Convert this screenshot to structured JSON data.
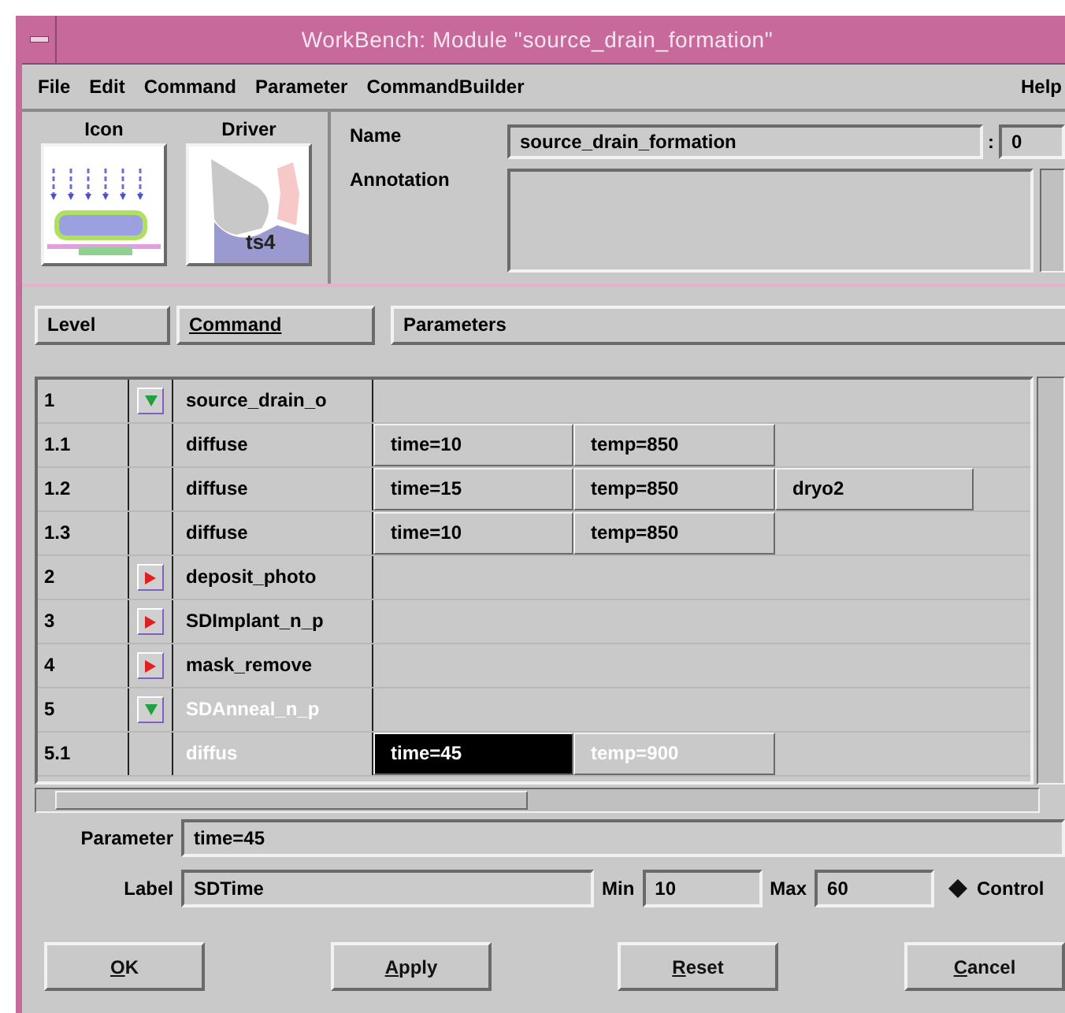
{
  "window": {
    "title": "WorkBench: Module \"source_drain_formation\""
  },
  "menu": {
    "items": [
      "File",
      "Edit",
      "Command",
      "Parameter",
      "CommandBuilder"
    ],
    "help": "Help"
  },
  "module": {
    "icon_label": "Icon",
    "driver_label": "Driver",
    "driver_badge": "ts4",
    "name_label": "Name",
    "name": "source_drain_formation",
    "separator": ":",
    "version": "0",
    "annotation_label": "Annotation"
  },
  "columns": [
    {
      "label": "Level",
      "sorted": false
    },
    {
      "label": "Command",
      "sorted": true
    },
    {
      "label": "Parameters",
      "sorted": false
    }
  ],
  "rows": [
    {
      "level": "1",
      "expanded": true,
      "command": "source_drain_o",
      "highlighted": false
    },
    {
      "level": "1.1",
      "command": "diffuse",
      "highlighted": false,
      "params": [
        {
          "text": "time=10",
          "selected": false
        },
        {
          "text": "temp=850",
          "selected": false
        }
      ]
    },
    {
      "level": "1.2",
      "command": "diffuse",
      "highlighted": false,
      "params": [
        {
          "text": "time=15",
          "selected": false
        },
        {
          "text": "temp=850",
          "selected": false
        },
        {
          "text": "dryo2",
          "selected": false
        }
      ]
    },
    {
      "level": "1.3",
      "command": "diffuse",
      "highlighted": false,
      "params": [
        {
          "text": "time=10",
          "selected": false
        },
        {
          "text": "temp=850",
          "selected": false
        }
      ]
    },
    {
      "level": "2",
      "expanded": false,
      "command": "deposit_photo",
      "highlighted": false
    },
    {
      "level": "3",
      "expanded": false,
      "command": "SDImplant_n_p",
      "highlighted": false
    },
    {
      "level": "4",
      "expanded": false,
      "command": "mask_remove",
      "highlighted": false
    },
    {
      "level": "5",
      "expanded": true,
      "command": "SDAnneal_n_p",
      "highlighted": true
    },
    {
      "level": "5.1",
      "command": "diffus",
      "highlighted": true,
      "params": [
        {
          "text": "time=45",
          "selected": true
        },
        {
          "text": "temp=900",
          "selected": false
        }
      ]
    }
  ],
  "parameter": {
    "label": "Parameter",
    "value": "time=45"
  },
  "label_row": {
    "label": "Label",
    "value": "SDTime",
    "min_label": "Min",
    "min": "10",
    "max_label": "Max",
    "max": "60",
    "control": {
      "label": "Control",
      "checked": true
    }
  },
  "buttons": [
    "OK",
    "Apply",
    "Reset",
    "Cancel"
  ]
}
